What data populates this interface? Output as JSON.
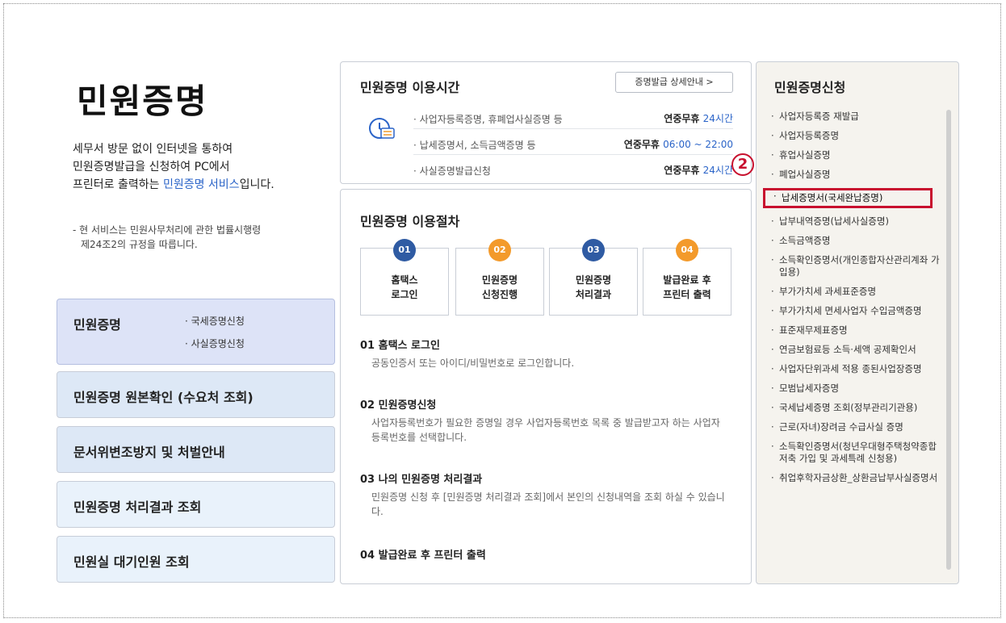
{
  "intro": {
    "title": "민원증명",
    "desc_line1": "세무서 방문 없이 인터넷을 통하여",
    "desc_line2": "민원증명발급을 신청하여 PC에서",
    "desc_line3_pre": "프린터로 출력하는 ",
    "desc_line3_link": "민원증명 서비스",
    "desc_line3_post": "입니다.",
    "note_line1": "- 현 서비스는 민원사무처리에 관한 법률시행령",
    "note_line2": "제24조2의 규정을 따릅니다."
  },
  "left_menu": {
    "main_label": "민원증명",
    "main_sub1": "· 국세증명신청",
    "main_sub2": "· 사실증명신청",
    "item2": "민원증명 원본확인 (수요처 조회)",
    "item3": "문서위변조방지 및 처벌안내",
    "item4": "민원증명 처리결과 조회",
    "item5": "민원실 대기인원 조회"
  },
  "hours": {
    "title": "민원증명 이용시간",
    "detail_button": "증명발급 상세안내 >",
    "rows": [
      {
        "name": "· 사업자등록증명, 휴폐업사실증명 등",
        "label": "연중무휴",
        "time": "24시간"
      },
      {
        "name": "· 납세증명서, 소득금액증명 등",
        "label": "연중무휴",
        "time": "06:00 ~ 22:00"
      },
      {
        "name": "· 사실증명발급신청",
        "label": "연중무휴",
        "time": "24시간"
      }
    ],
    "marker": "2"
  },
  "procedure": {
    "title": "민원증명 이용절차",
    "steps": [
      {
        "num": "01",
        "label": "홈택스\n로그인",
        "color": "#2f5ba3"
      },
      {
        "num": "02",
        "label": "민원증명\n신청진행",
        "color": "#f39a2b"
      },
      {
        "num": "03",
        "label": "민원증명\n처리결과",
        "color": "#2f5ba3"
      },
      {
        "num": "04",
        "label": "발급완료 후\n프린터 출력",
        "color": "#f39a2b"
      }
    ],
    "sections": [
      {
        "title": "01 홈택스 로그인",
        "desc": "공동인증서 또는 아이디/비밀번호로 로그인합니다."
      },
      {
        "title": "02 민원증명신청",
        "desc": "사업자등록번호가 필요한 증명일 경우 사업자등록번호 목록 중 발급받고자 하는 사업자등록번호를 선택합니다."
      },
      {
        "title": "03 나의 민원증명 처리결과",
        "desc": "민원증명 신청 후 [민원증명 처리결과 조회]에서 본인의 신청내역을 조회 하실 수 있습니다."
      },
      {
        "title": "04 발급완료 후 프린터 출력",
        "desc": ""
      }
    ]
  },
  "apply_panel": {
    "title": "민원증명신청",
    "items": [
      "사업자등록증 재발급",
      "사업자등록증명",
      "휴업사실증명",
      "폐업사실증명",
      "납세증명서(국세완납증명)",
      "납부내역증명(납세사실증명)",
      "소득금액증명",
      "소득확인증명서(개인종합자산관리계좌 가입용)",
      "부가가치세 과세표준증명",
      "부가가치세 면세사업자 수입금액증명",
      "표준재무제표증명",
      "연금보험료등 소득·세액 공제확인서",
      "사업자단위과세 적용 종된사업장증명",
      "모범납세자증명",
      "국세납세증명 조회(정부관리기관용)",
      "근로(자녀)장려금 수급사실 증명",
      "소득확인증명서(청년우대형주택청약종합저축 가입 및 과세특례 신청용)",
      "취업후학자금상환_상환금납부사실증명서"
    ],
    "highlight_color": "#c8102e"
  }
}
